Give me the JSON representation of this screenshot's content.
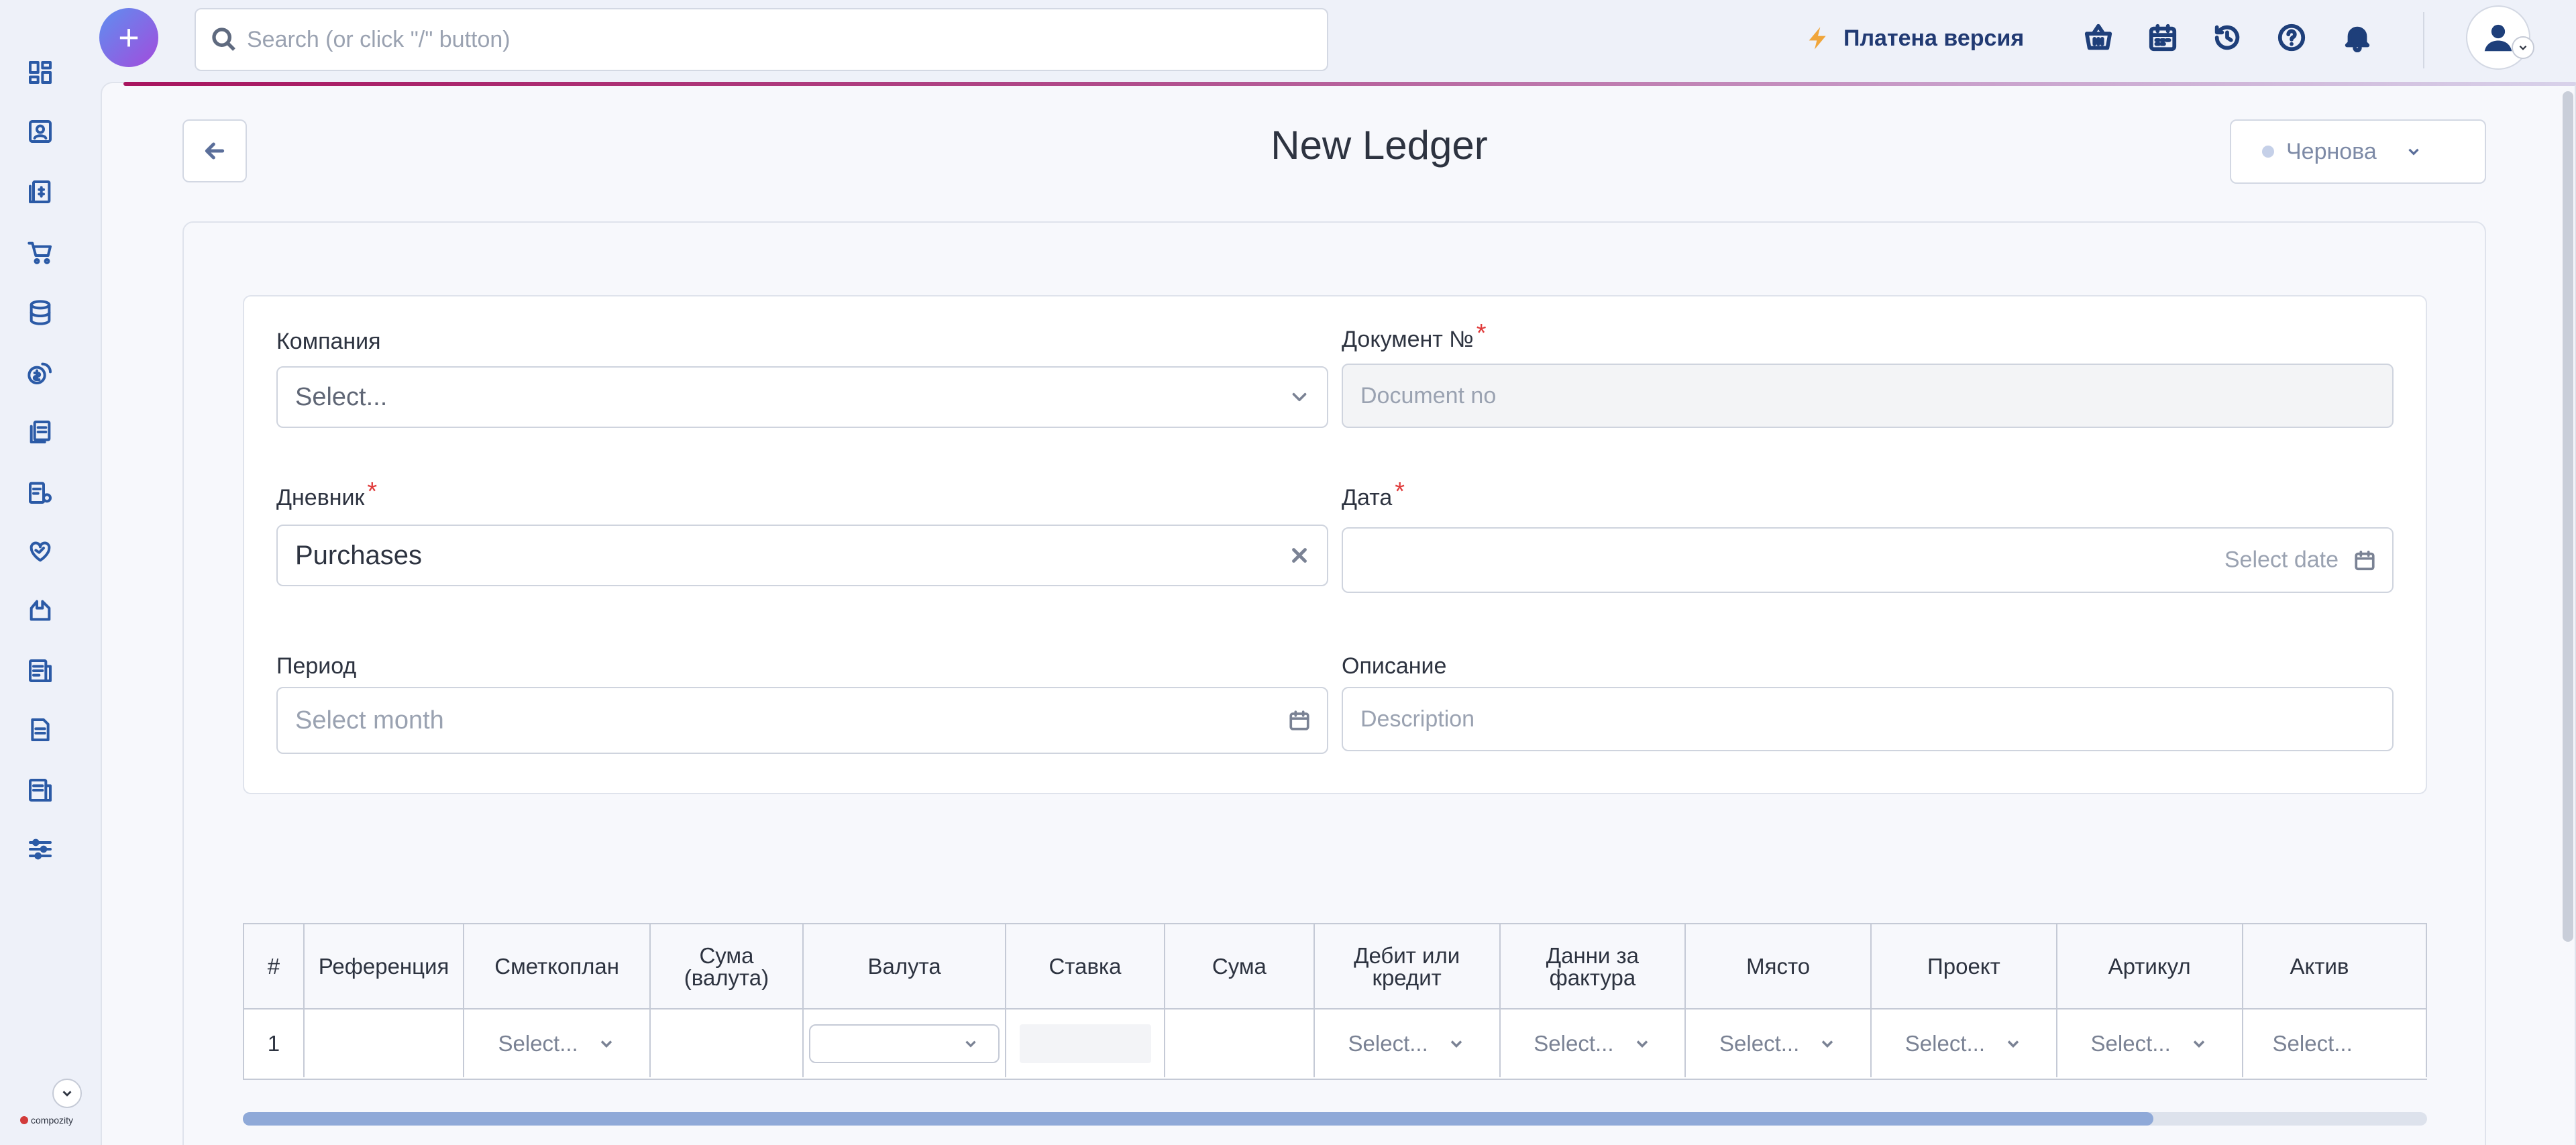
{
  "topbar": {
    "search_placeholder": "Search (or click \"/\" button)",
    "plan_label": "Платена версия",
    "add_label": "+"
  },
  "sidebar": {
    "brand": "compozity"
  },
  "page": {
    "title": "New Ledger",
    "status": "Чернова"
  },
  "form": {
    "company": {
      "label": "Компания",
      "placeholder": "Select..."
    },
    "document_no": {
      "label": "Документ №",
      "placeholder": "Document no",
      "required": "*"
    },
    "journal": {
      "label": "Дневник",
      "value": "Purchases",
      "required": "*"
    },
    "date": {
      "label": "Дата",
      "placeholder": "Select date",
      "required": "*"
    },
    "period": {
      "label": "Период",
      "placeholder": "Select month"
    },
    "description": {
      "label": "Описание",
      "placeholder": "Description"
    }
  },
  "table": {
    "columns": [
      {
        "key": "num",
        "label": "#"
      },
      {
        "key": "reference",
        "label": "Референция"
      },
      {
        "key": "account",
        "label": "Сметкоплан"
      },
      {
        "key": "amount_currency",
        "label": "Сума (валута)"
      },
      {
        "key": "currency",
        "label": "Валута"
      },
      {
        "key": "rate",
        "label": "Ставка"
      },
      {
        "key": "amount",
        "label": "Сума"
      },
      {
        "key": "debit_credit",
        "label": "Дебит или кредит"
      },
      {
        "key": "invoice_data",
        "label": "Данни за фактура"
      },
      {
        "key": "location",
        "label": "Място"
      },
      {
        "key": "project",
        "label": "Проект"
      },
      {
        "key": "article",
        "label": "Артикул"
      },
      {
        "key": "asset",
        "label": "Актив"
      }
    ],
    "rows": [
      {
        "num": "1",
        "account": "Select...",
        "debit_credit": "Select...",
        "invoice_data": "Select...",
        "location": "Select...",
        "project": "Select...",
        "article": "Select...",
        "asset": "Select..."
      }
    ]
  },
  "colors": {
    "accent_gradient_start": "#a8155f",
    "brand_blue": "#1e3f7a",
    "required": "#e03a3a",
    "plan_icon": "#f0a53a"
  }
}
